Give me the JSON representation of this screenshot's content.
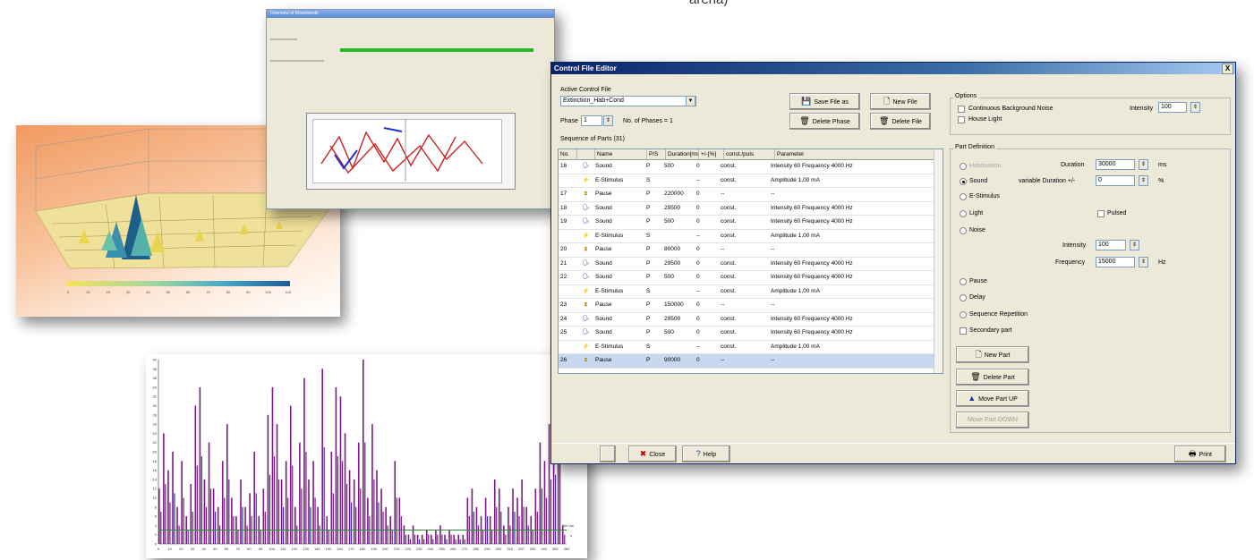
{
  "caption": "arena)",
  "colors": {
    "accent_bar": "#7b1a86",
    "threshold_line": "#2e8b2e",
    "title_blue": "#0a246a"
  },
  "shot_panel": {
    "title": "Overview of Movements"
  },
  "bar_chart": {
    "threshold_label": "Ref.Val",
    "x_axis_letter": "s"
  },
  "chart_data": {
    "type": "bar",
    "x": [
      0,
      4,
      8,
      12,
      16,
      20,
      24,
      28,
      32,
      36,
      40,
      44,
      48,
      52,
      56,
      60,
      64,
      68,
      72,
      76,
      80,
      84,
      88,
      92,
      96,
      100,
      104,
      108,
      112,
      116,
      120,
      124,
      128,
      132,
      136,
      140,
      144,
      148,
      152,
      156,
      160,
      164,
      168,
      172,
      176,
      180,
      184,
      188,
      192,
      196,
      200,
      204,
      208,
      212,
      216,
      220,
      224,
      228,
      232,
      236,
      240,
      244,
      248,
      252,
      256,
      260,
      264,
      268,
      272,
      276,
      280,
      284,
      288,
      292,
      296,
      300,
      304,
      308,
      312,
      316,
      320,
      324,
      328,
      332,
      336,
      340,
      344,
      348,
      352,
      356
    ],
    "values": [
      12,
      24,
      16,
      20,
      8,
      18,
      6,
      13,
      30,
      34,
      14,
      22,
      12,
      8,
      18,
      26,
      10,
      6,
      14,
      8,
      11,
      20,
      6,
      12,
      28,
      34,
      26,
      14,
      18,
      30,
      8,
      22,
      36,
      14,
      18,
      8,
      38,
      6,
      20,
      34,
      32,
      24,
      16,
      14,
      22,
      40,
      10,
      26,
      16,
      12,
      8,
      6,
      18,
      10,
      4,
      2,
      4,
      2,
      2,
      3,
      2,
      3,
      4,
      2,
      3,
      2,
      2,
      2,
      10,
      12,
      8,
      6,
      10,
      6,
      14,
      12,
      4,
      8,
      12,
      10,
      14,
      8,
      6,
      12,
      22,
      18,
      26,
      28,
      34,
      4
    ],
    "xlim": [
      0,
      360
    ],
    "ylim": [
      0,
      40
    ],
    "x_ticks": [
      0,
      10,
      20,
      30,
      40,
      50,
      60,
      70,
      80,
      90,
      100,
      110,
      120,
      130,
      140,
      150,
      160,
      170,
      180,
      190,
      200,
      210,
      220,
      230,
      240,
      250,
      260,
      270,
      280,
      290,
      300,
      310,
      320,
      330,
      340,
      350,
      360
    ],
    "y_ticks": [
      0,
      2,
      4,
      6,
      8,
      10,
      12,
      14,
      16,
      18,
      20,
      22,
      24,
      26,
      28,
      30,
      32,
      34,
      36,
      38,
      40
    ],
    "threshold": 3
  },
  "legend_ticks": [
    "0",
    "10",
    "20",
    "30",
    "40",
    "50",
    "60",
    "70",
    "80",
    "90",
    "100",
    "110"
  ],
  "editor": {
    "title": "Control File Editor",
    "close_x": "X",
    "active_label": "Active Control File",
    "active_file": "Extinction_Hab+Cond",
    "phase_label": "Phase",
    "phase_value": "1",
    "phases_text": "No. of Phases = 1",
    "seq_label": "Sequence of Parts (31)",
    "btn_save_as": "Save File as",
    "btn_new_file": "New File",
    "btn_delete_phase": "Delete Phase",
    "btn_delete_file": "Delete File",
    "columns": [
      "No.",
      "",
      "Name",
      "P/S",
      "Duration[ms]",
      "+/-[%]",
      "const./puls",
      "Parameter"
    ],
    "rows": [
      {
        "no": "16",
        "icon": "sound",
        "name": "Sound",
        "ps": "P",
        "dur": "500",
        "pm": "0",
        "cp": "const.",
        "param": "Intensity 60 Frequency 4000 Hz"
      },
      {
        "no": "",
        "icon": "stim",
        "name": "E-Stimulus",
        "ps": "S",
        "dur": "",
        "pm": "--",
        "cp": "const.",
        "param": "Amplitude 1,00 mA"
      },
      {
        "no": "17",
        "icon": "pause",
        "name": "Pause",
        "ps": "P",
        "dur": "220000",
        "pm": "0",
        "cp": "--",
        "param": "--"
      },
      {
        "no": "18",
        "icon": "sound",
        "name": "Sound",
        "ps": "P",
        "dur": "29500",
        "pm": "0",
        "cp": "const.",
        "param": "Intensity 60 Frequency 4000 Hz"
      },
      {
        "no": "19",
        "icon": "sound",
        "name": "Sound",
        "ps": "P",
        "dur": "500",
        "pm": "0",
        "cp": "const.",
        "param": "Intensity 60 Frequency 4000 Hz"
      },
      {
        "no": "",
        "icon": "stim",
        "name": "E-Stimulus",
        "ps": "S",
        "dur": "",
        "pm": "--",
        "cp": "const.",
        "param": "Amplitude 1,00 mA"
      },
      {
        "no": "20",
        "icon": "pause",
        "name": "Pause",
        "ps": "P",
        "dur": "80000",
        "pm": "0",
        "cp": "--",
        "param": "--"
      },
      {
        "no": "21",
        "icon": "sound",
        "name": "Sound",
        "ps": "P",
        "dur": "29500",
        "pm": "0",
        "cp": "const.",
        "param": "Intensity 60 Frequency 4000 Hz"
      },
      {
        "no": "22",
        "icon": "sound",
        "name": "Sound",
        "ps": "P",
        "dur": "500",
        "pm": "0",
        "cp": "const.",
        "param": "Intensity 60 Frequency 4000 Hz"
      },
      {
        "no": "",
        "icon": "stim",
        "name": "E-Stimulus",
        "ps": "S",
        "dur": "",
        "pm": "--",
        "cp": "const.",
        "param": "Amplitude 1,00 mA"
      },
      {
        "no": "23",
        "icon": "pause",
        "name": "Pause",
        "ps": "P",
        "dur": "150000",
        "pm": "0",
        "cp": "--",
        "param": "--"
      },
      {
        "no": "24",
        "icon": "sound",
        "name": "Sound",
        "ps": "P",
        "dur": "29500",
        "pm": "0",
        "cp": "const.",
        "param": "Intensity 60 Frequency 4000 Hz"
      },
      {
        "no": "25",
        "icon": "sound",
        "name": "Sound",
        "ps": "P",
        "dur": "500",
        "pm": "0",
        "cp": "const.",
        "param": "Intensity 60 Frequency 4000 Hz"
      },
      {
        "no": "",
        "icon": "stim",
        "name": "E-Stimulus",
        "ps": "S",
        "dur": "",
        "pm": "--",
        "cp": "const.",
        "param": "Amplitude 1,00 mA"
      },
      {
        "no": "26",
        "icon": "pause",
        "name": "Pause",
        "ps": "P",
        "dur": "90000",
        "pm": "0",
        "cp": "--",
        "param": "--",
        "selected": true
      }
    ],
    "options_label": "Options",
    "opt_bg_noise": "Continuous Background Noise",
    "opt_intensity_label": "Intensity",
    "opt_intensity_value": "100",
    "opt_house_light": "House Light",
    "partdef_label": "Part Definition",
    "r_habituation": "Habituation",
    "r_sound": "Sound",
    "r_estim": "E-Stimulus",
    "r_light": "Light",
    "r_noise": "Noise",
    "r_pause": "Pause",
    "r_delay": "Delay",
    "r_seqrep": "Sequence Repetition",
    "c_secondary": "Secondary part",
    "c_pulsed": "Pulsed",
    "duration_label": "Duration",
    "duration_value": "30000",
    "duration_unit": "ms",
    "vardur_label": "variable Duration +/-",
    "vardur_value": "0",
    "vardur_unit": "%",
    "intensity_label": "Intensity",
    "intensity_value": "100",
    "frequency_label": "Frequency",
    "frequency_value": "15000",
    "frequency_unit": "Hz",
    "btn_new_part": "New Part",
    "btn_delete_part": "Delete Part",
    "btn_move_up": "Move Part UP",
    "btn_move_down": "Move Part DOWN",
    "btn_close": "Close",
    "btn_help": "Help",
    "btn_print": "Print"
  }
}
